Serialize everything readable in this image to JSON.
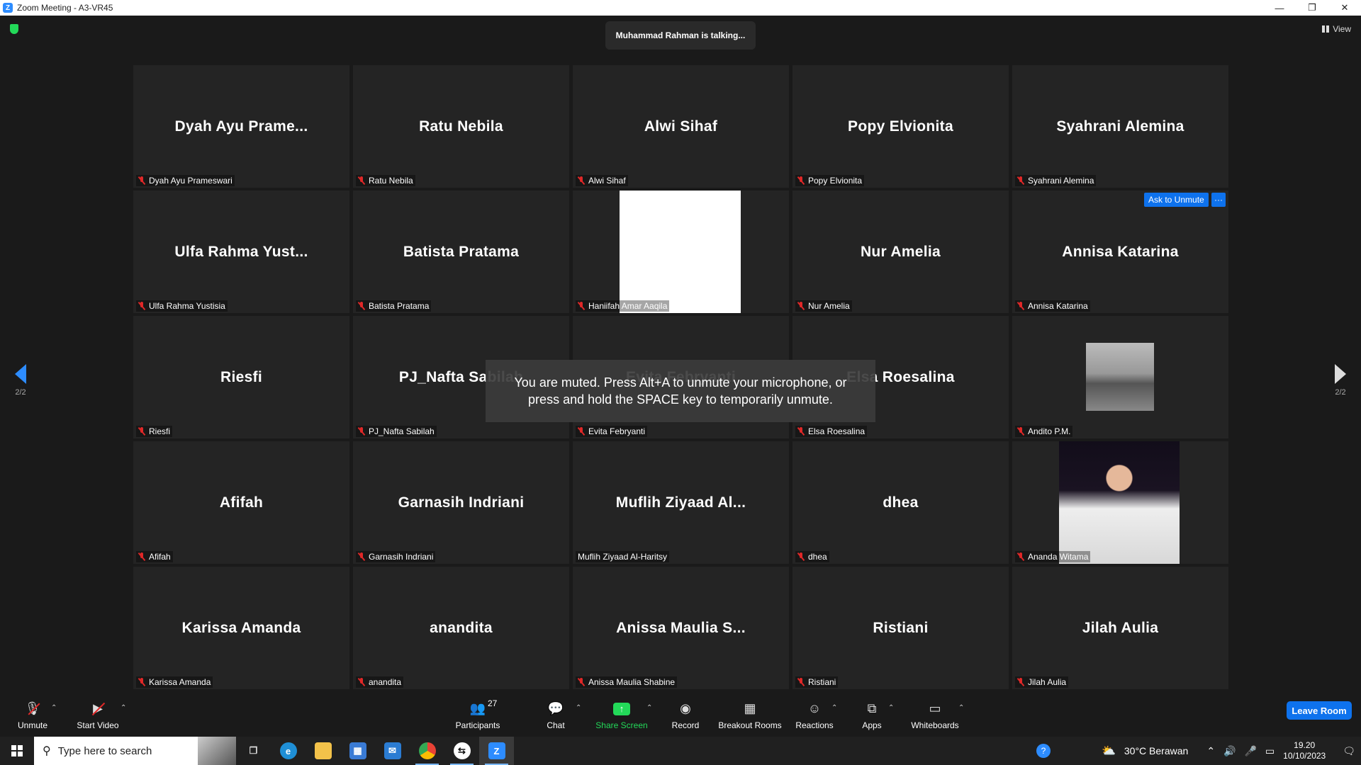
{
  "window": {
    "title": "Zoom Meeting - A3-VR45",
    "controls": [
      "—",
      "❐",
      "✕"
    ]
  },
  "meeting": {
    "talking_banner": "Muhammad Rahman is talking...",
    "view_label": "View",
    "ask_to_unmute": "Ask to Unmute",
    "more": "···",
    "muted_toast": "You are muted. Press Alt+A to unmute your microphone, or press and hold the SPACE key to temporarily unmute.",
    "page_left": "2/2",
    "page_right": "2/2"
  },
  "tiles": [
    {
      "big": "Dyah Ayu Prame...",
      "label": "Dyah Ayu Prameswari",
      "muted": true
    },
    {
      "big": "Ratu Nebila",
      "label": "Ratu Nebila",
      "muted": true
    },
    {
      "big": "Alwi Sihaf",
      "label": "Alwi Sihaf",
      "muted": true
    },
    {
      "big": "Popy Elvionita",
      "label": "Popy Elvionita",
      "muted": true
    },
    {
      "big": "Syahrani Alemina",
      "label": "Syahrani Alemina",
      "muted": true
    },
    {
      "big": "Ulfa Rahma Yust...",
      "label": "Ulfa Rahma Yustisia",
      "muted": true
    },
    {
      "big": "Batista Pratama",
      "label": "Batista Pratama",
      "muted": true
    },
    {
      "big": "",
      "label": "Haniifah Amar Aaqila",
      "muted": true,
      "media": "white-video"
    },
    {
      "big": "Nur Amelia",
      "label": "Nur Amelia",
      "muted": true
    },
    {
      "big": "Annisa Katarina",
      "label": "Annisa Katarina",
      "muted": true
    },
    {
      "big": "Riesfi",
      "label": "Riesfi",
      "muted": true
    },
    {
      "big": "PJ_Nafta Sabilah",
      "label": "PJ_Nafta Sabilah",
      "muted": true
    },
    {
      "big": "Evita Febryanti",
      "label": "Evita Febryanti",
      "muted": true
    },
    {
      "big": "Elsa Roesalina",
      "label": "Elsa Roesalina",
      "muted": true
    },
    {
      "big": "",
      "label": "Andito P.M.",
      "muted": true,
      "media": "car-photo"
    },
    {
      "big": "Afifah",
      "label": "Afifah",
      "muted": true
    },
    {
      "big": "Garnasih Indriani",
      "label": "Garnasih Indriani",
      "muted": true
    },
    {
      "big": "Muflih Ziyaad Al...",
      "label": "Muflih Ziyaad Al-Haritsy",
      "muted": false
    },
    {
      "big": "dhea",
      "label": "dhea",
      "muted": true
    },
    {
      "big": "",
      "label": "Ananda Witama",
      "muted": true,
      "media": "person-video"
    },
    {
      "big": "Karissa Amanda",
      "label": "Karissa Amanda",
      "muted": true
    },
    {
      "big": "anandita",
      "label": "anandita",
      "muted": true
    },
    {
      "big": "Anissa Maulia S...",
      "label": "Anissa Maulia Shabine",
      "muted": true
    },
    {
      "big": "Ristiani",
      "label": "Ristiani",
      "muted": true
    },
    {
      "big": "Jilah Aulia",
      "label": "Jilah Aulia",
      "muted": true
    }
  ],
  "toolbar": {
    "unmute": "Unmute",
    "start_video": "Start Video",
    "participants": "Participants",
    "participants_count": "27",
    "chat": "Chat",
    "share_screen": "Share Screen",
    "record": "Record",
    "breakout_rooms": "Breakout Rooms",
    "reactions": "Reactions",
    "apps": "Apps",
    "whiteboards": "Whiteboards",
    "leave": "Leave Room",
    "share_color": "#23d959"
  },
  "taskbar": {
    "search_placeholder": "Type here to search",
    "weather": "30°C  Berawan",
    "time": "19.20",
    "date": "10/10/2023"
  }
}
